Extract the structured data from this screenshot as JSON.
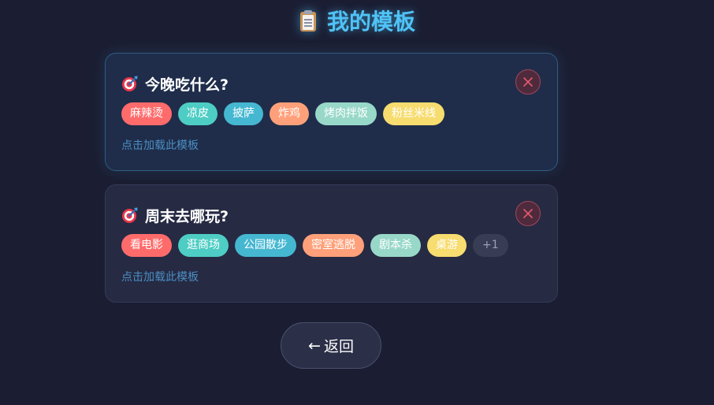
{
  "header": {
    "title": "我的模板",
    "icon": "clipboard-icon"
  },
  "templates": [
    {
      "title": "今晚吃什么?",
      "icon": "target-icon",
      "tags": [
        {
          "label": "麻辣烫",
          "color": "#ff6b6b"
        },
        {
          "label": "凉皮",
          "color": "#4ecdc4"
        },
        {
          "label": "披萨",
          "color": "#45b7d1"
        },
        {
          "label": "炸鸡",
          "color": "#ffa07a"
        },
        {
          "label": "烤肉拌饭",
          "color": "#98d8c8"
        },
        {
          "label": "粉丝米线",
          "color": "#f7dc6f"
        }
      ],
      "load_label": "点击加载此模板"
    },
    {
      "title": "周末去哪玩?",
      "icon": "target-icon",
      "tags": [
        {
          "label": "看电影",
          "color": "#ff6b6b"
        },
        {
          "label": "逛商场",
          "color": "#4ecdc4"
        },
        {
          "label": "公园散步",
          "color": "#45b7d1"
        },
        {
          "label": "密室逃脱",
          "color": "#ffa07a"
        },
        {
          "label": "剧本杀",
          "color": "#98d8c8"
        },
        {
          "label": "桌游",
          "color": "#f7dc6f"
        }
      ],
      "more_label": "+1",
      "load_label": "点击加载此模板"
    }
  ],
  "back_button": {
    "arrow": "←",
    "label": "返回"
  },
  "colors": {
    "accent": "#4fc3f7",
    "background": "#1b1e33",
    "delete": "#e05a6e"
  }
}
